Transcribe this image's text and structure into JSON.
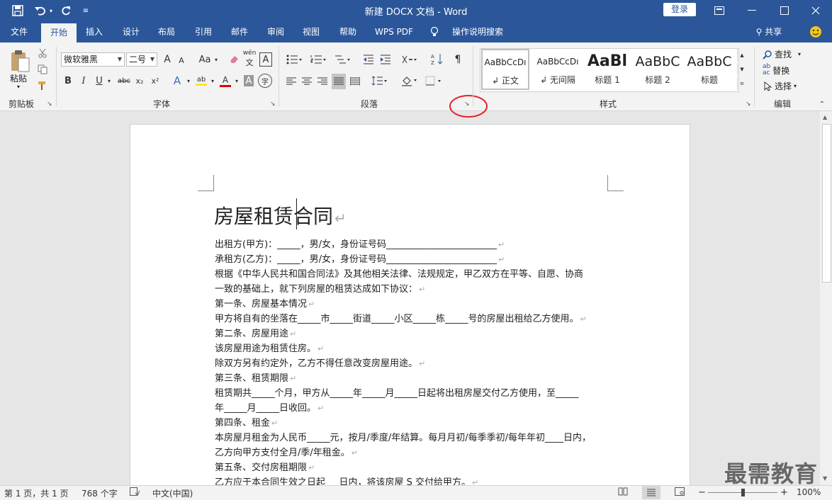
{
  "titlebar": {
    "title": "新建 DOCX 文档 - Word",
    "login_label": "登录",
    "qat": [
      "save-icon",
      "undo-icon",
      "redo-icon",
      "customize-icon"
    ]
  },
  "tabs": [
    "文件",
    "开始",
    "插入",
    "设计",
    "布局",
    "引用",
    "邮件",
    "审阅",
    "视图",
    "帮助",
    "WPS PDF",
    "操作说明搜索"
  ],
  "active_tab": "开始",
  "share_label": "共享",
  "ribbon": {
    "clipboard": {
      "paste_label": "粘贴",
      "group_label": "剪贴板"
    },
    "font": {
      "font_name": "微软雅黑",
      "font_size": "二号",
      "group_label": "字体",
      "bold": "B",
      "italic": "I",
      "underline": "U",
      "strike": "abc",
      "sub": "x₂",
      "sup": "x²",
      "grow": "A",
      "shrink": "A",
      "case": "Aa",
      "phonetic": "wén",
      "border": "A",
      "highlight": "ab",
      "color": "A",
      "shade": "A",
      "enclose": "字"
    },
    "paragraph": {
      "group_label": "段落"
    },
    "styles": {
      "group_label": "样式",
      "items": [
        {
          "preview": "AaBbCcDı",
          "name": "↲ 正文"
        },
        {
          "preview": "AaBbCcDı",
          "name": "↲ 无间隔"
        },
        {
          "preview": "AaBl",
          "name": "标题 1"
        },
        {
          "preview": "AaBbC",
          "name": "标题 2"
        },
        {
          "preview": "AaBbC",
          "name": "标题"
        }
      ]
    },
    "editing": {
      "group_label": "编辑",
      "find": "查找",
      "replace": "替换",
      "select": "选择"
    }
  },
  "document": {
    "title": "房屋租赁合同",
    "lines": [
      "出租方(甲方)：_____，男/女，身份证号码________________________",
      "承租方(乙方)：_____，男/女，身份证号码________________________",
      "根据《中华人民共和国合同法》及其他相关法律、法规规定，甲乙双方在平等、自愿、协商",
      "一致的基础上，就下列房屋的租赁达成如下协议：",
      "第一条、房屋基本情况",
      "甲方将自有的坐落在_____市_____街道_____小区_____栋_____号的房屋出租给乙方使用。",
      "第二条、房屋用途",
      "该房屋用途为租赁住房。",
      "除双方另有约定外，乙方不得任意改变房屋用途。",
      "第三条、租赁期限",
      "租赁期共_____个月，甲方从_____年_____月_____日起将出租房屋交付乙方使用，至_____",
      "年_____月_____日收回。",
      "第四条、租金",
      "本房屋月租金为人民币_____元，按月/季度/年结算。每月月初/每季季初/每年年初____日内，",
      "乙方向甲方支付全月/季/年租金。",
      "第五条、交付房租期限",
      "乙方应于本合同生效之日起___日内，将该房屋 S 交付给甲方。"
    ],
    "paragraph_mark": "↵",
    "line_end_marks": [
      true,
      true,
      false,
      true,
      true,
      true,
      true,
      true,
      true,
      true,
      false,
      true,
      true,
      false,
      true,
      true,
      true
    ]
  },
  "statusbar": {
    "page": "第 1 页，共 1 页",
    "words": "768 个字",
    "lang": "中文(中国)",
    "zoom": "100%"
  },
  "watermark": "最需教育"
}
